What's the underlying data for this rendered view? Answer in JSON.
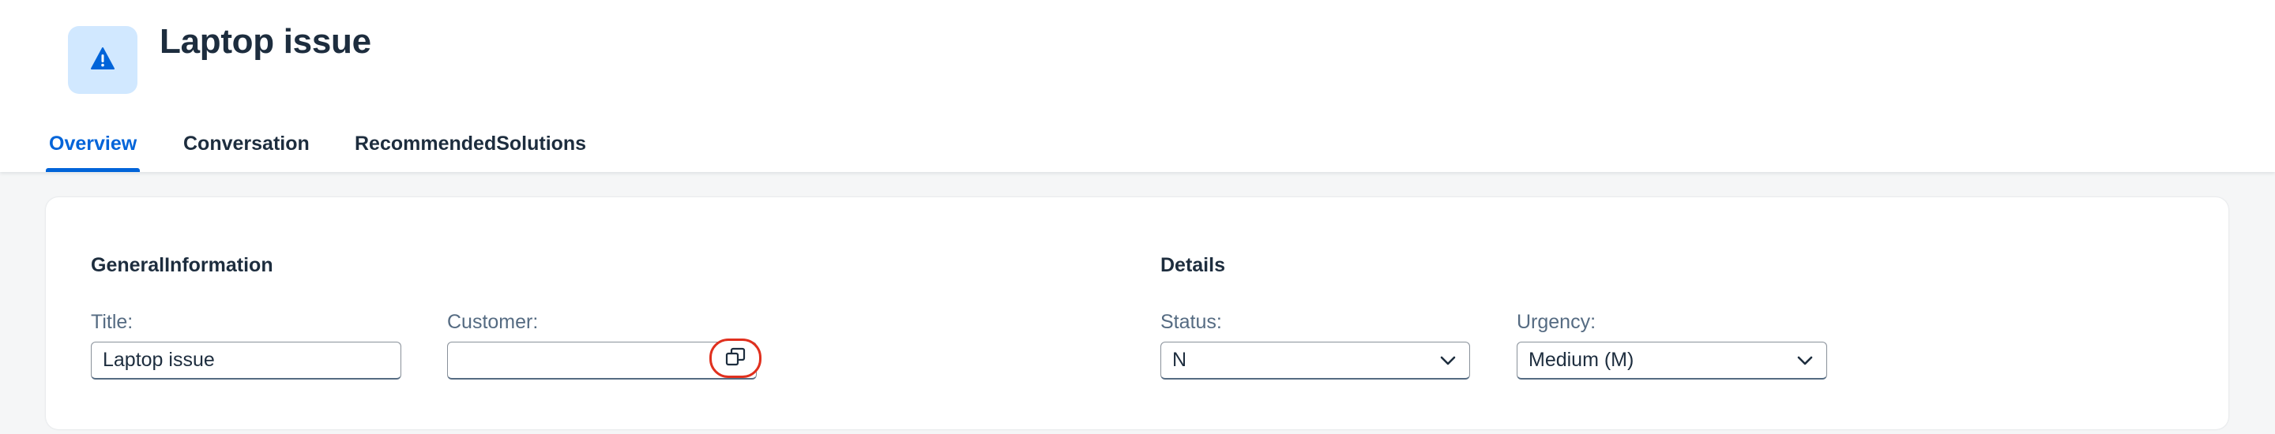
{
  "header": {
    "title": "Laptop issue",
    "object_icon": "warning-icon"
  },
  "tabs": [
    {
      "label": "Overview",
      "active": true
    },
    {
      "label": "Conversation",
      "active": false
    },
    {
      "label": "RecommendedSolutions",
      "active": false
    }
  ],
  "general_information": {
    "section_title": "GeneralInformation",
    "title_label": "Title:",
    "title_value": "Laptop issue",
    "customer_label": "Customer:",
    "customer_value": "",
    "customer_value_help_icon": "value-help-icon"
  },
  "details": {
    "section_title": "Details",
    "status_label": "Status:",
    "status_value": "N",
    "urgency_label": "Urgency:",
    "urgency_value": "Medium (M)"
  },
  "colors": {
    "accent": "#0064d9",
    "highlight": "#e0301e",
    "icon_background": "#d1e8ff"
  }
}
